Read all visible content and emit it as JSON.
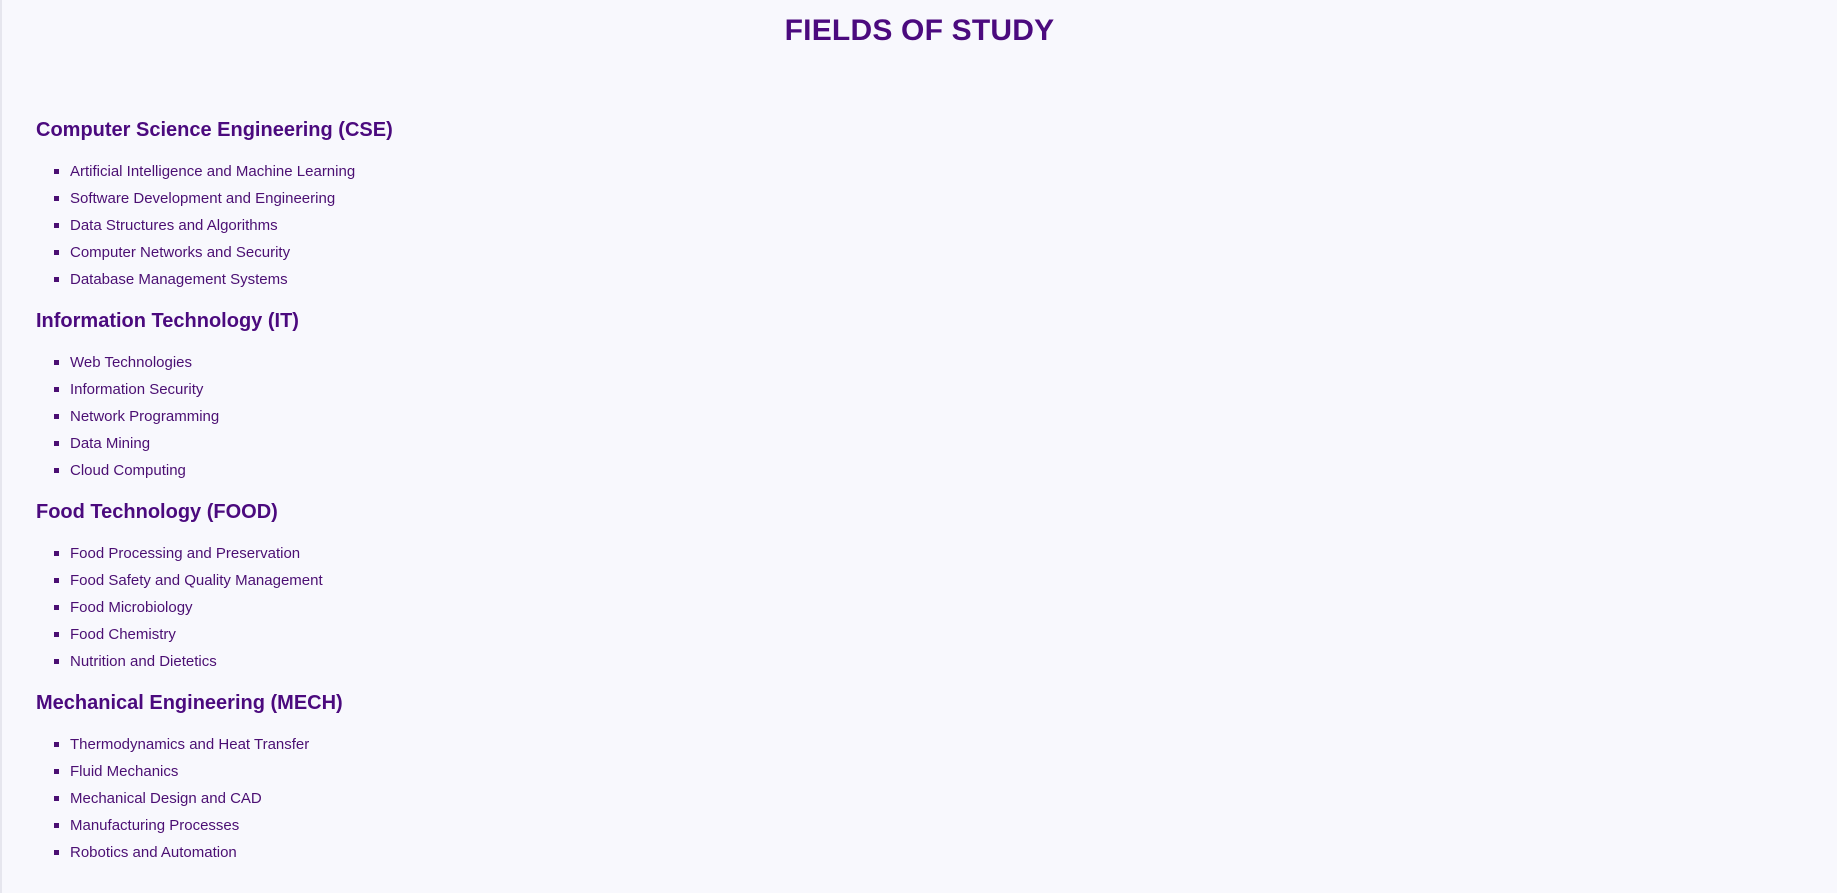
{
  "page": {
    "title": "FIELDS OF STUDY"
  },
  "sections": [
    {
      "heading": "Computer Science Engineering (CSE)",
      "items": [
        "Artificial Intelligence and Machine Learning",
        "Software Development and Engineering",
        "Data Structures and Algorithms",
        "Computer Networks and Security",
        "Database Management Systems"
      ]
    },
    {
      "heading": "Information Technology (IT)",
      "items": [
        "Web Technologies",
        "Information Security",
        "Network Programming",
        "Data Mining",
        "Cloud Computing"
      ]
    },
    {
      "heading": "Food Technology (FOOD)",
      "items": [
        "Food Processing and Preservation",
        "Food Safety and Quality Management",
        "Food Microbiology",
        "Food Chemistry",
        "Nutrition and Dietetics"
      ]
    },
    {
      "heading": "Mechanical Engineering (MECH)",
      "items": [
        "Thermodynamics and Heat Transfer",
        "Fluid Mechanics",
        "Mechanical Design and CAD",
        "Manufacturing Processes",
        "Robotics and Automation"
      ]
    }
  ],
  "colors": {
    "accent": "#4b0a7e",
    "text": "#4b0f73",
    "background": "#f8f8fd"
  },
  "icons": {
    "bullet": "square-bullet-icon"
  }
}
